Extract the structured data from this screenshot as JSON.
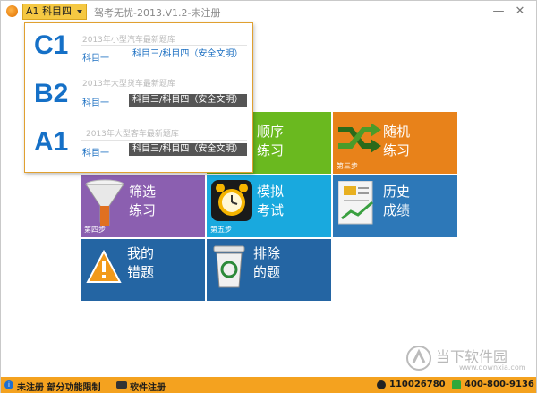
{
  "titlebar": {
    "subject_select": "A1 科目四",
    "window_title": "驾考无忧-2013.V1.2-未注册",
    "minimize": "—",
    "close": "✕"
  },
  "licence_menu": [
    {
      "code": "C1",
      "desc": "2013年小型汽车最新题库",
      "sub1": "科目一",
      "sub2": "科目三/科目四（安全文明）",
      "selected": false
    },
    {
      "code": "B2",
      "desc": "2013年大型货车最新题库",
      "sub1": "科目一",
      "sub2": "科目三/科目四（安全文明）",
      "selected": true
    },
    {
      "code": "A1",
      "desc": "2013年大型客车最新题库",
      "sub1": "科目一",
      "sub2": "科目三/科目四（安全文明）",
      "selected": true
    }
  ],
  "tiles": {
    "sequential": {
      "line1": "顺序",
      "line2": "练习"
    },
    "random": {
      "line1": "随机",
      "line2": "练习",
      "step": "第三步"
    },
    "filter": {
      "line1": "筛选",
      "line2": "练习",
      "step": "第四步"
    },
    "mock": {
      "line1": "模拟",
      "line2": "考试",
      "step": "第五步"
    },
    "history": {
      "line1": "历史",
      "line2": "成绩"
    },
    "wrong": {
      "line1": "我的",
      "line2": "错题"
    },
    "exclude": {
      "line1": "排除",
      "line2": "的题"
    }
  },
  "statusbar": {
    "unregistered": "未注册 部分功能限制",
    "register": "软件注册",
    "qq": "110026780",
    "phone": "400-800-9136"
  },
  "watermark": {
    "brand": "当下软件园",
    "url": "www.downxia.com"
  },
  "colors": {
    "accent": "#f4a21f",
    "link": "#1b6fc2",
    "green": "#6ab91f",
    "orange": "#e8821a",
    "purple": "#8b5fb0",
    "cyan": "#19a9de",
    "blue": "#2d78b8"
  }
}
